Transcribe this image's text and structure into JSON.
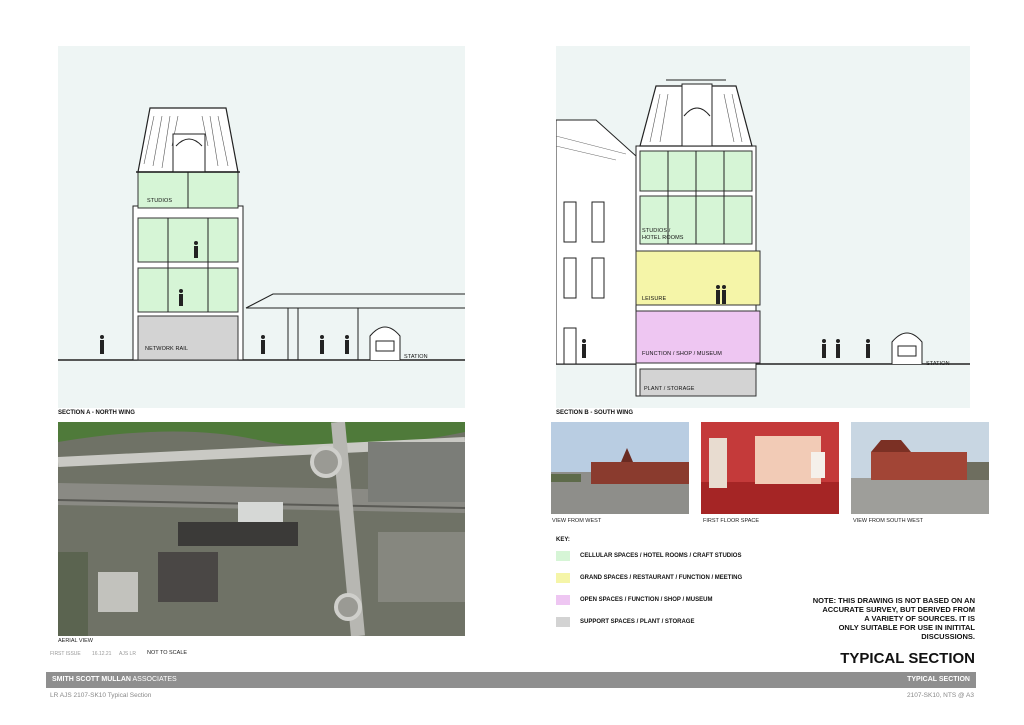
{
  "section_a": {
    "caption": "SECTION A - NORTH WING",
    "labels": {
      "studios": "STUDIOS",
      "network_rail": "NETWORK RAIL",
      "station": "STATION"
    }
  },
  "section_b": {
    "caption": "SECTION B - SOUTH WING",
    "labels": {
      "studios_line1": "STUDIOS /",
      "studios_line2": "HOTEL ROOMS",
      "leisure": "LEISURE",
      "function": "FUNCTION / SHOP / MUSEUM",
      "plant": "PLANT / STORAGE",
      "station": "STATION"
    }
  },
  "aerial": {
    "caption": "AERIAL VIEW"
  },
  "photos": [
    {
      "caption": "VIEW FROM WEST"
    },
    {
      "caption": "FIRST FLOOR SPACE"
    },
    {
      "caption": "VIEW FROM SOUTH WEST"
    }
  ],
  "key": {
    "title": "KEY:",
    "items": [
      {
        "label": "CELLULAR SPACES / HOTEL ROOMS / CRAFT STUDIOS",
        "color": "#d6f5d6"
      },
      {
        "label": "GRAND SPACES / RESTAURANT / FUNCTION / MEETING",
        "color": "#f5f5a8"
      },
      {
        "label": "OPEN SPACES / FUNCTION / SHOP / MUSEUM",
        "color": "#eec6f2"
      },
      {
        "label": "SUPPORT SPACES / PLANT / STORAGE",
        "color": "#d3d3d3"
      }
    ]
  },
  "note": {
    "line1": "NOTE: THIS DRAWING IS NOT BASED ON AN",
    "line2": "ACCURATE SURVEY, BUT DERIVED FROM",
    "line3": "A VARIETY OF SOURCES. IT IS",
    "line4": "ONLY SUITABLE FOR USE IN INITITAL",
    "line5": "DISCUSSIONS."
  },
  "issue": {
    "label": "FIRST ISSUE",
    "date": "16.12.21",
    "initials": "AJS LR",
    "scale": "NOT TO SCALE"
  },
  "sheet_title": "TYPICAL SECTION",
  "footer": {
    "firm_bold": "SMITH SCOTT MULLAN",
    "firm_rest": "ASSOCIATES",
    "right_title": "TYPICAL SECTION",
    "left_ref": "LR AJS 2107-SK10 Typical Section",
    "right_ref": "2107-SK10, NTS @ A3"
  }
}
